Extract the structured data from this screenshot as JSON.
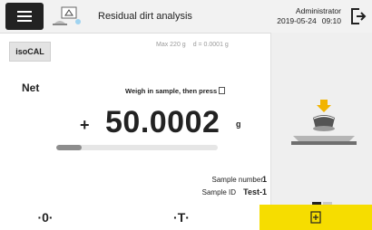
{
  "header": {
    "title": "Residual dirt analysis",
    "user": "Administrator",
    "date": "2019-05-24",
    "time": "09:10"
  },
  "isocal_label": "isoCAL",
  "range": {
    "max": "Max 220 g",
    "d": "d = 0.0001 g"
  },
  "mode_label": "Net",
  "instruction": "Weigh in sample, then press",
  "weight": {
    "sign": "+",
    "value": "50.0002",
    "unit": "g",
    "progress_fraction": 0.16
  },
  "info": {
    "sample_number_label": "Sample number",
    "sample_number_value": "1",
    "sample_id_label": "Sample ID",
    "sample_id_value": "Test-1"
  },
  "footer": {
    "zero": "·0·",
    "tare": "·T·"
  },
  "colors": {
    "accent": "#f6dd00",
    "header_bg": "#f2f2f2",
    "panel_bg": "#efefef"
  },
  "icons": [
    "menu-icon",
    "balance-app-icon",
    "logout-icon",
    "ok-icon",
    "scale-illustration"
  ]
}
